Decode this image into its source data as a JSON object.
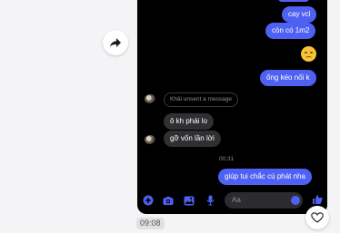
{
  "messages": {
    "out_1": "cay vcl",
    "out_2": "còn có 1m2",
    "out_3": "ống kéo nối k",
    "unsent_notice": "Khải unsent a message",
    "in_1": "ô kh phải lo",
    "in_2": "gỡ vốn lần lời",
    "timestamp": "00:31",
    "out_4": "giúp tui chắc cú phát nha"
  },
  "composer": {
    "placeholder": "Aa"
  },
  "video": {
    "current_time": "09:08"
  },
  "colors": {
    "outgoing_bubble": "#4f61f2",
    "incoming_bubble": "#303033",
    "chat_background": "#000000",
    "accent": "#4f61f2"
  },
  "icons": {
    "share": "share-arrow-icon",
    "like": "heart-icon",
    "composer": [
      "plus-icon",
      "camera-icon",
      "gallery-icon",
      "microphone-icon",
      "emoji-icon",
      "thumbs-up-icon"
    ]
  }
}
